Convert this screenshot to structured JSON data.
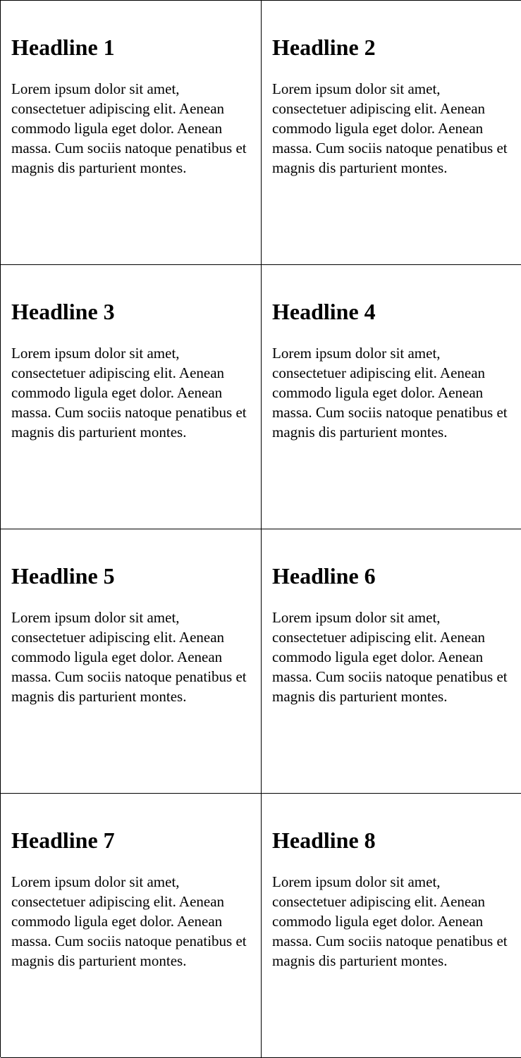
{
  "cells": [
    {
      "headline": "Headline 1",
      "body": "Lorem ipsum dolor sit amet, consectetuer adipiscing elit. Aenean commodo ligula eget dolor. Aenean massa. Cum sociis natoque penatibus et magnis dis parturient montes."
    },
    {
      "headline": "Headline 2",
      "body": "Lorem ipsum dolor sit amet, consectetuer adipiscing elit. Aenean commodo ligula eget dolor. Aenean massa. Cum sociis natoque penatibus et magnis dis parturient montes."
    },
    {
      "headline": "Headline 3",
      "body": "Lorem ipsum dolor sit amet, consectetuer adipiscing elit. Aenean commodo ligula eget dolor. Aenean massa. Cum sociis natoque penatibus et magnis dis parturient montes."
    },
    {
      "headline": "Headline 4",
      "body": "Lorem ipsum dolor sit amet, consectetuer adipiscing elit. Aenean commodo ligula eget dolor. Aenean massa. Cum sociis natoque penatibus et magnis dis parturient montes."
    },
    {
      "headline": "Headline 5",
      "body": "Lorem ipsum dolor sit amet, consectetuer adipiscing elit. Aenean commodo ligula eget dolor. Aenean massa. Cum sociis natoque penatibus et magnis dis parturient montes."
    },
    {
      "headline": "Headline 6",
      "body": "Lorem ipsum dolor sit amet, consectetuer adipiscing elit. Aenean commodo ligula eget dolor. Aenean massa. Cum sociis natoque penatibus et magnis dis parturient montes."
    },
    {
      "headline": "Headline 7",
      "body": "Lorem ipsum dolor sit amet, consectetuer adipiscing elit. Aenean commodo ligula eget dolor. Aenean massa. Cum sociis natoque penatibus et magnis dis parturient montes."
    },
    {
      "headline": "Headline 8",
      "body": "Lorem ipsum dolor sit amet, consectetuer adipiscing elit. Aenean commodo ligula eget dolor. Aenean massa. Cum sociis natoque penatibus et magnis dis parturient montes."
    }
  ]
}
